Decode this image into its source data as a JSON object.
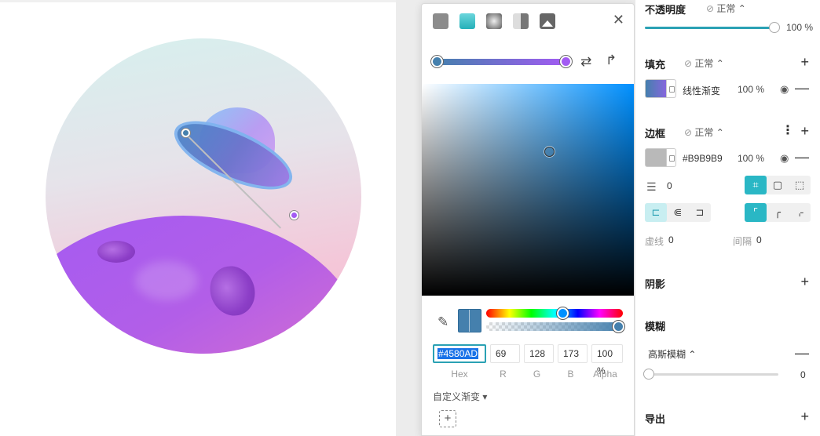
{
  "colors": {
    "accent": "#2AA1B4",
    "gradient_start": "#4580AD",
    "gradient_end": "#A35BF3",
    "border_color": "#B9B9B9"
  },
  "picker": {
    "fill_types": [
      "solid-fill-icon",
      "linear-gradient-icon",
      "radial-gradient-icon",
      "angular-gradient-icon",
      "image-fill-icon"
    ],
    "close_label": "✕",
    "hex_value": "#4580AD",
    "r_value": "69",
    "g_value": "128",
    "b_value": "173",
    "alpha_value": "100 %",
    "labels": {
      "hex": "Hex",
      "r": "R",
      "g": "G",
      "b": "B",
      "alpha": "Alpha"
    },
    "custom_gradient_label": "自定义渐变 ▾",
    "add_label": "+",
    "hue_position": 0.56,
    "alpha_position": 1.0,
    "sv_saturation": 0.6,
    "sv_value": 0.68
  },
  "inspector": {
    "opacity": {
      "title": "不透明度",
      "mode": "正常",
      "value": "100 %",
      "level": 1.0
    },
    "fill": {
      "title": "填充",
      "mode": "正常",
      "type_label": "线性渐变",
      "value": "100 %"
    },
    "border": {
      "title": "边框",
      "mode": "正常",
      "color_hex": "#B9B9B9",
      "value": "100 %",
      "width": "0",
      "dash_label": "虚线",
      "dash_value": "0",
      "gap_label": "间隔",
      "gap_value": "0"
    },
    "shadow": {
      "title": "阴影"
    },
    "blur": {
      "title": "模糊",
      "type": "高斯模糊",
      "value": "0",
      "level": 0
    },
    "export": {
      "title": "导出"
    },
    "mode_suffix": "⌃",
    "plus": "+",
    "minus": "—"
  }
}
